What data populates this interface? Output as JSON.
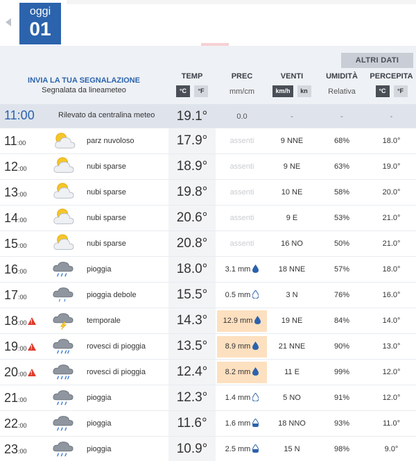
{
  "date": {
    "day_name": "oggi",
    "day_num": "01"
  },
  "altri_dati": "ALTRI DATI",
  "report": {
    "line1": "INVIA LA TUA SEGNALAZIONE",
    "line2": "Segnalata da lineameteo"
  },
  "headers": {
    "temp": "TEMP",
    "temp_units": [
      "°C",
      "°F"
    ],
    "prec": "PREC",
    "prec_sub": "mm/cm",
    "venti": "VENTI",
    "venti_units": [
      "km/h",
      "kn"
    ],
    "umidita": "UMIDITÀ",
    "umidita_sub": "Relativa",
    "percepita": "PERCEPITA",
    "percepita_units": [
      "°C",
      "°F"
    ]
  },
  "now": {
    "time": "11:00",
    "label": "Rilevato da centralina meteo",
    "temp": "19.1°",
    "prec": "0.0",
    "wind": "-",
    "hum": "-",
    "perc": "-"
  },
  "rows": [
    {
      "h": "11",
      "m": ":00",
      "warn": false,
      "icon": "partly-cloudy-icon",
      "desc": "parz nuvoloso",
      "temp": "17.9°",
      "prec": "assenti",
      "prec_state": "absent",
      "wind": "9  NNE",
      "hum": "68%",
      "perc": "18.0°"
    },
    {
      "h": "12",
      "m": ":00",
      "warn": false,
      "icon": "scattered-clouds-icon",
      "desc": "nubi sparse",
      "temp": "18.9°",
      "prec": "assenti",
      "prec_state": "absent",
      "wind": "9  NE",
      "hum": "63%",
      "perc": "19.0°"
    },
    {
      "h": "13",
      "m": ":00",
      "warn": false,
      "icon": "scattered-clouds-icon",
      "desc": "nubi sparse",
      "temp": "19.8°",
      "prec": "assenti",
      "prec_state": "absent",
      "wind": "10  NE",
      "hum": "58%",
      "perc": "20.0°"
    },
    {
      "h": "14",
      "m": ":00",
      "warn": false,
      "icon": "scattered-clouds-icon",
      "desc": "nubi sparse",
      "temp": "20.6°",
      "prec": "assenti",
      "prec_state": "absent",
      "wind": "9  E",
      "hum": "53%",
      "perc": "21.0°"
    },
    {
      "h": "15",
      "m": ":00",
      "warn": false,
      "icon": "scattered-clouds-icon",
      "desc": "nubi sparse",
      "temp": "20.8°",
      "prec": "assenti",
      "prec_state": "absent",
      "wind": "16  NO",
      "hum": "50%",
      "perc": "21.0°"
    },
    {
      "h": "16",
      "m": ":00",
      "warn": false,
      "icon": "rain-icon",
      "desc": "pioggia",
      "temp": "18.0°",
      "prec": "3.1 mm",
      "prec_state": "normal",
      "drop": "full",
      "wind": "18  NNE",
      "hum": "57%",
      "perc": "18.0°"
    },
    {
      "h": "17",
      "m": ":00",
      "warn": false,
      "icon": "light-rain-icon",
      "desc": "pioggia debole",
      "temp": "15.5°",
      "prec": "0.5 mm",
      "prec_state": "normal",
      "drop": "empty",
      "wind": "3  N",
      "hum": "76%",
      "perc": "16.0°"
    },
    {
      "h": "18",
      "m": ":00",
      "warn": true,
      "icon": "thunderstorm-icon",
      "desc": "temporale",
      "temp": "14.3°",
      "prec": "12.9 mm",
      "prec_state": "high",
      "drop": "full",
      "wind": "19  NE",
      "hum": "84%",
      "perc": "14.0°"
    },
    {
      "h": "19",
      "m": ":00",
      "warn": true,
      "icon": "showers-icon",
      "desc": "rovesci di pioggia",
      "temp": "13.5°",
      "prec": "8.9 mm",
      "prec_state": "high",
      "drop": "full",
      "wind": "21  NNE",
      "hum": "90%",
      "perc": "13.0°"
    },
    {
      "h": "20",
      "m": ":00",
      "warn": true,
      "icon": "showers-icon",
      "desc": "rovesci di pioggia",
      "temp": "12.4°",
      "prec": "8.2 mm",
      "prec_state": "high",
      "drop": "full",
      "wind": "11  E",
      "hum": "99%",
      "perc": "12.0°"
    },
    {
      "h": "21",
      "m": ":00",
      "warn": false,
      "icon": "rain-icon",
      "desc": "pioggia",
      "temp": "12.3°",
      "prec": "1.4 mm",
      "prec_state": "normal",
      "drop": "empty",
      "wind": "5  NO",
      "hum": "91%",
      "perc": "12.0°"
    },
    {
      "h": "22",
      "m": ":00",
      "warn": false,
      "icon": "rain-icon",
      "desc": "pioggia",
      "temp": "11.6°",
      "prec": "1.6 mm",
      "prec_state": "normal",
      "drop": "half",
      "wind": "18  NNO",
      "hum": "93%",
      "perc": "11.0°"
    },
    {
      "h": "23",
      "m": ":00",
      "warn": false,
      "icon": "rain-icon",
      "desc": "pioggia",
      "temp": "10.9°",
      "prec": "2.5 mm",
      "prec_state": "normal",
      "drop": "half",
      "wind": "15  N",
      "hum": "98%",
      "perc": "9.0°"
    }
  ]
}
